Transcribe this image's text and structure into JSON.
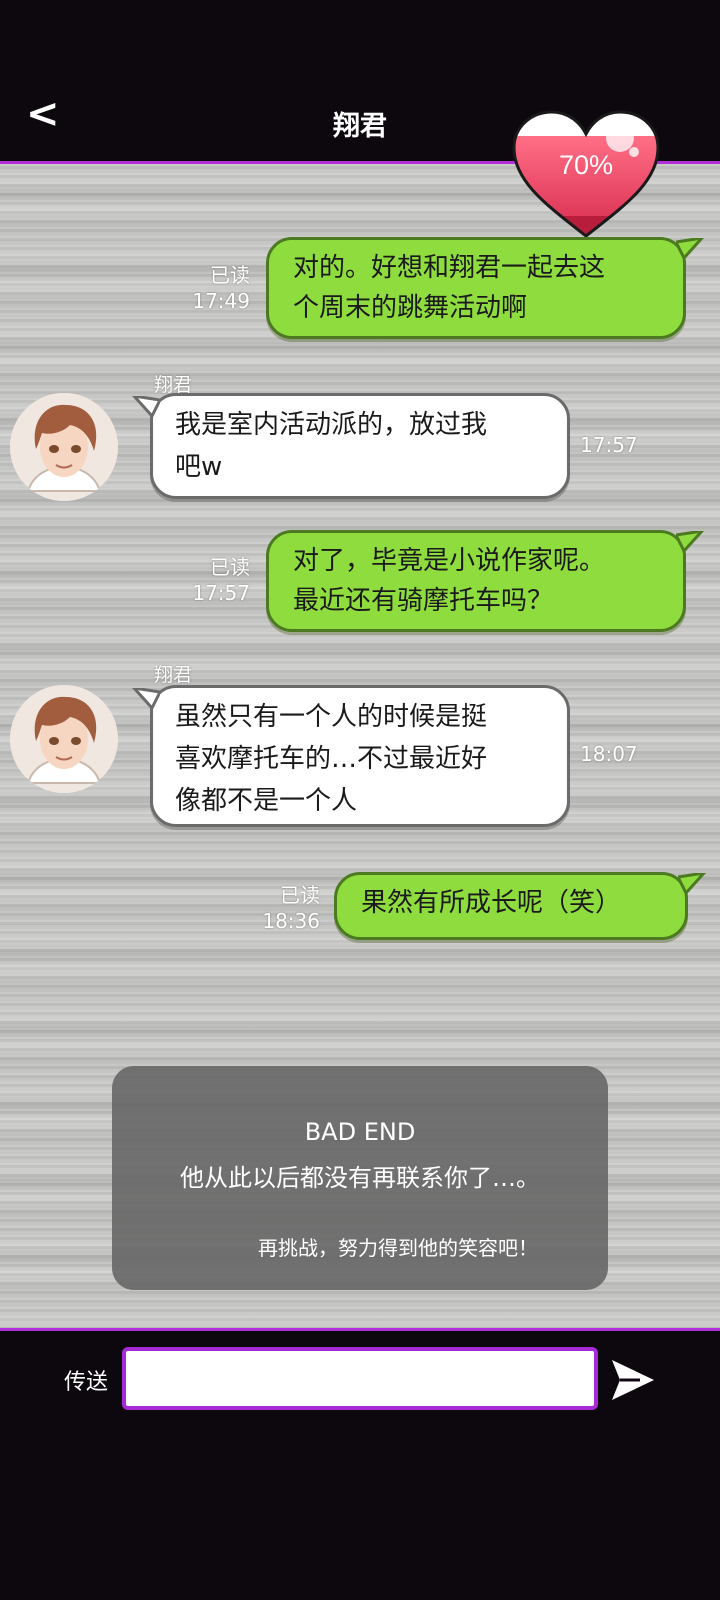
{
  "header": {
    "back_label": "<",
    "title": "翔君",
    "affection": "70%"
  },
  "messages": [
    {
      "side": "right",
      "lines": [
        "对的。好想和翔君一起去这",
        "个周末的跳舞活动啊"
      ],
      "status": "已读",
      "time": "17:49"
    },
    {
      "side": "left",
      "sender": "翔君",
      "lines": [
        "我是室内活动派的，放过我",
        "吧w"
      ],
      "time": "17:57"
    },
    {
      "side": "right",
      "lines": [
        "对了，毕竟是小说作家呢。",
        "最近还有骑摩托车吗？"
      ],
      "status": "已读",
      "time": "17:57"
    },
    {
      "side": "left",
      "sender": "翔君",
      "lines": [
        "虽然只有一个人的时候是挺",
        "喜欢摩托车的…不过最近好",
        "像都不是一个人"
      ],
      "time": "18:07"
    },
    {
      "side": "right",
      "lines": [
        "果然有所成长呢（笑）"
      ],
      "status": "已读",
      "time": "18:36"
    }
  ],
  "overlay": {
    "title": "BAD END",
    "line": "他从此以后都没有再联系你了…。",
    "retry": "再挑战，努力得到他的笑容吧！"
  },
  "footer": {
    "send_label": "传送",
    "input_value": ""
  },
  "colors": {
    "accent": "#b02fd8",
    "bubble_right": "#8fdc3e",
    "bubble_left": "#ffffff",
    "heart": "#e8435f"
  }
}
